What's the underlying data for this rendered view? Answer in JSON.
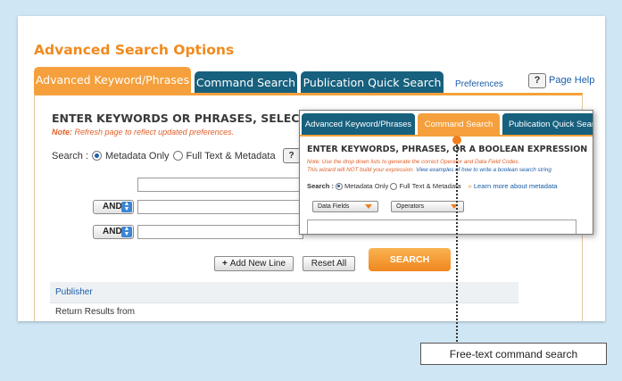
{
  "page": {
    "title": "Advanced Search Options"
  },
  "tabs": [
    {
      "label": "Advanced Keyword/Phrases",
      "active": true
    },
    {
      "label": "Command Search",
      "active": false
    },
    {
      "label": "Publication Quick Search",
      "active": false
    }
  ],
  "header_links": {
    "preferences": "Preferences",
    "help_icon": "?",
    "page_help": "Page Help"
  },
  "form": {
    "heading": "ENTER KEYWORDS OR PHRASES, SELECT FIELD",
    "note_label": "Note:",
    "note_text": "Refresh page to reflect updated preferences.",
    "search_label": "Search :",
    "radio_options": [
      "Metadata Only",
      "Full Text & Metadata"
    ],
    "selected_radio": "Metadata Only",
    "help_icon": "?",
    "operator_1": "AND",
    "operator_2": "AND",
    "add_new_line": "Add New Line",
    "reset_all": "Reset All",
    "search_button": "SEARCH",
    "publisher_label": "Publisher",
    "return_results_label": "Return Results from"
  },
  "overlay": {
    "tabs": [
      {
        "label": "Advanced Keyword/Phrases",
        "active": false
      },
      {
        "label": "Command Search",
        "active": true
      },
      {
        "label": "Publication Quick Sear",
        "active": false
      }
    ],
    "heading": "ENTER KEYWORDS, PHRASES, OR A BOOLEAN EXPRESSION",
    "note_line_1": "Note: Use the drop down lists to generate the correct Operator and Data Field Codes.",
    "note_line_2a": "This wizard will NOT build your expression.",
    "note_line_2b": "View examples of how to write a boolean search string",
    "search_label": "Search :",
    "radio_options": [
      "Metadata Only",
      "Full Text & Metadata"
    ],
    "learn_more_star": "»",
    "learn_more": "Learn more about metadata",
    "data_fields": "Data Fields",
    "operators": "Operators"
  },
  "callout": {
    "text": "Free-text command search"
  },
  "colors": {
    "accent_orange": "#f5a03c",
    "tab_blue": "#17607e",
    "title_orange": "#f08a1e",
    "link_blue": "#1a5da8",
    "background": "#cfe6f4"
  }
}
